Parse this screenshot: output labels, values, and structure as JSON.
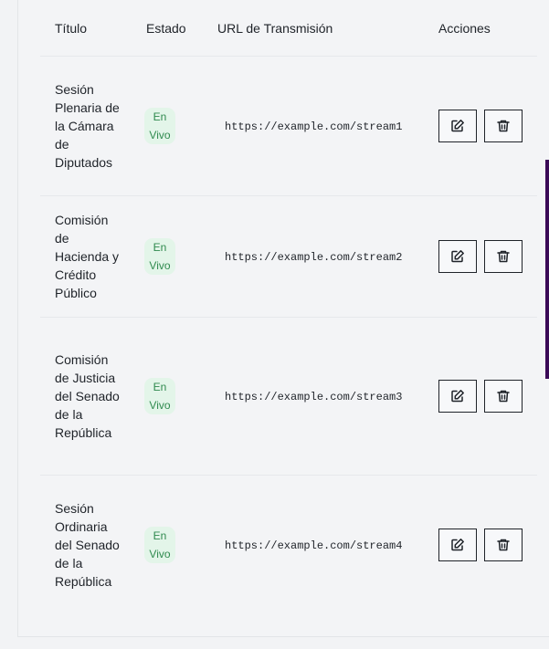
{
  "table": {
    "headers": {
      "title": "Título",
      "status": "Estado",
      "url": "URL de Transmisión",
      "actions": "Acciones"
    },
    "rows": [
      {
        "title": "Sesión Plenaria de la Cámara de Diputados",
        "status": "En Vivo",
        "url": "https://example.com/stream1"
      },
      {
        "title": "Comisión de Hacienda y Crédito Público",
        "status": "En Vivo",
        "url": "https://example.com/stream2"
      },
      {
        "title": "Comisión de Justicia del Senado de la República",
        "status": "En Vivo",
        "url": "https://example.com/stream3"
      },
      {
        "title": "Sesión Ordinaria del Senado de la República",
        "status": "En Vivo",
        "url": "https://example.com/stream4"
      }
    ],
    "row_actions": {
      "edit_icon": "edit-icon",
      "delete_icon": "trash-icon"
    }
  },
  "colors": {
    "status_badge_bg": "#e3f5e9",
    "status_badge_text": "#2f8a4e",
    "accent": "#3b0a57"
  }
}
